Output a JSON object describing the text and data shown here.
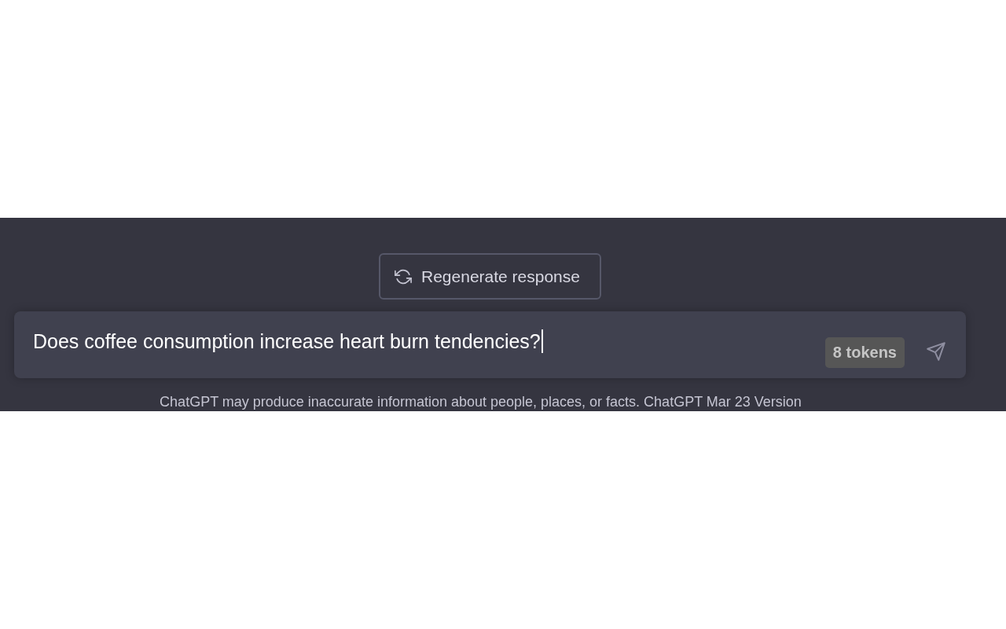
{
  "regenerate_button": {
    "label": "Regenerate response"
  },
  "composer": {
    "value": "Does coffee consumption increase heart burn tendencies?",
    "token_count": "8 tokens"
  },
  "footer_note": "ChatGPT may produce inaccurate information about people, places, or facts. ChatGPT Mar 23 Version"
}
